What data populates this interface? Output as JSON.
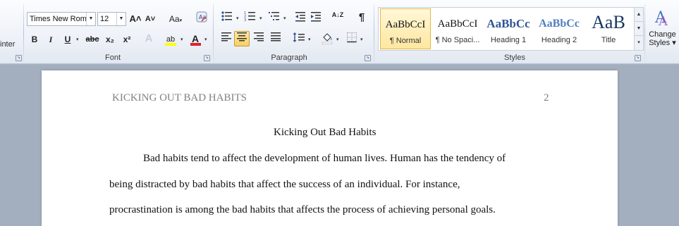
{
  "clipboard": {
    "format_painter_partial": "inter"
  },
  "font": {
    "group_label": "Font",
    "name": "Times New Rom",
    "size": "12",
    "grow_icon": "A˄",
    "shrink_icon": "A˅",
    "change_case": "Aa",
    "clear_format_icon": "clear-formatting-icon",
    "bold": "B",
    "italic": "I",
    "underline": "U",
    "strikethrough": "abc",
    "subscript": "x₂",
    "superscript": "x²",
    "text_effects": "A",
    "highlight": "ab",
    "font_color": "A",
    "highlight_color": "#ffff00",
    "font_color_value": "#e0202a"
  },
  "paragraph": {
    "group_label": "Paragraph",
    "pilcrow": "¶",
    "sort": "A↓Z"
  },
  "styles": {
    "group_label": "Styles",
    "items": [
      {
        "sample": "AaBbCcI",
        "name": "¶ Normal"
      },
      {
        "sample": "AaBbCcI",
        "name": "¶ No Spaci..."
      },
      {
        "sample": "AaBbCс",
        "name": "Heading 1"
      },
      {
        "sample": "AaBbCc",
        "name": "Heading 2"
      },
      {
        "sample": "AaB",
        "name": "Title"
      }
    ],
    "change_styles_line1": "Change",
    "change_styles_line2": "Styles ▾"
  },
  "document": {
    "header_text": "KICKING OUT BAD HABITS",
    "header_page_number": "2",
    "title": "Kicking Out Bad Habits",
    "lines": [
      "Bad habits tend to affect the development of human lives. Human has the tendency of",
      "being distracted by bad habits that affect the success of an individual. For instance,",
      "procrastination is among the bad habits that affects the process of achieving personal goals."
    ]
  }
}
